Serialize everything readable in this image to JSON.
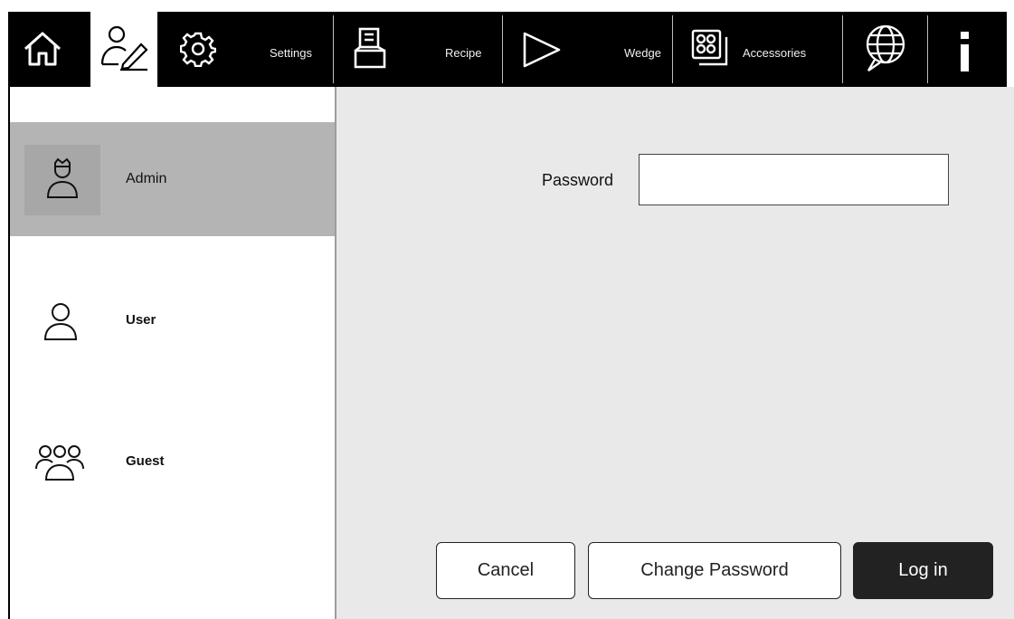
{
  "toolbar": {
    "home_icon": "home-icon",
    "user_icon": "user-edit-icon",
    "settings_icon": "gear-icon",
    "settings_label": "Settings",
    "recipe_icon": "recipe-icon",
    "recipe_label": "Recipe",
    "wedge_icon": "triangle-play-icon",
    "wedge_label": "Wedge",
    "accessories_icon": "accessories-icon",
    "accessories_label": "Accessories",
    "language_icon": "globe-chat-icon",
    "info_icon": "info-icon"
  },
  "sidebar": {
    "items": [
      {
        "label": "Admin",
        "icon": "admin-crown-icon",
        "selected": true
      },
      {
        "label": "User",
        "icon": "user-icon",
        "selected": false
      },
      {
        "label": "Guest",
        "icon": "group-icon",
        "selected": false
      }
    ]
  },
  "login": {
    "password_label": "Password",
    "password_value": "",
    "password_placeholder": ""
  },
  "buttons": {
    "cancel": "Cancel",
    "change_password": "Change Password",
    "login": "Log in"
  },
  "colors": {
    "toolbar_bg": "#000000",
    "selected_row": "#b4b4b4",
    "content_bg": "#e9e9e9",
    "primary_button": "#222222"
  }
}
